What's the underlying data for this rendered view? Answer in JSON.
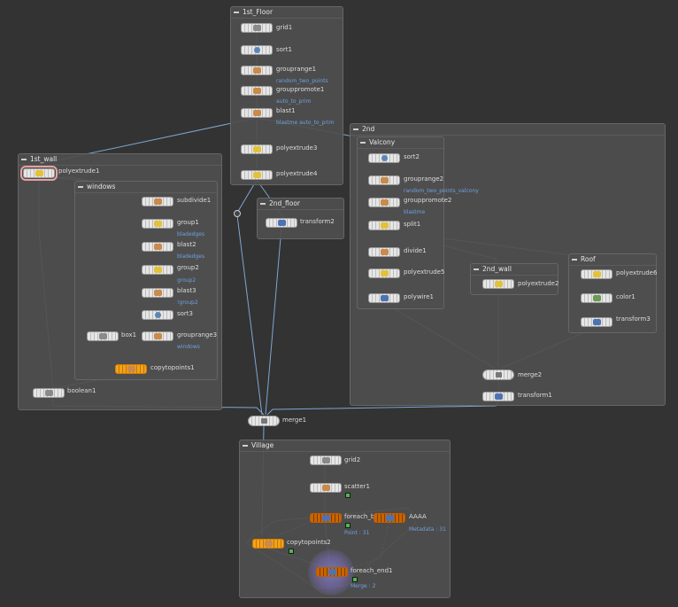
{
  "colors": {
    "wire": "#7fa6d1",
    "wire_orange": "#d9822b",
    "link": "#6fa0e0",
    "green_flag": "#4db84d"
  },
  "boxes": {
    "first_floor": {
      "title": "1st_Floor"
    },
    "first_wall": {
      "title": "1st_wall"
    },
    "windows": {
      "title": "windows"
    },
    "second_floor": {
      "title": "2nd_floor"
    },
    "second": {
      "title": "2nd"
    },
    "valcony": {
      "title": "Valcony"
    },
    "second_wall": {
      "title": "2nd_wall"
    },
    "roof": {
      "title": "Roof"
    },
    "village": {
      "title": "Village"
    }
  },
  "nodes": {
    "grid1": {
      "label": "grid1",
      "icon": "grid-icon"
    },
    "sort1": {
      "label": "sort1",
      "icon": "sort-icon"
    },
    "grouprange1": {
      "label": "grouprange1",
      "sub": "random_two_points",
      "icon": "grouprange-icon"
    },
    "grouppromote1": {
      "label": "grouppromote1",
      "sub": "auto_to_prim",
      "icon": "grouppromote-icon"
    },
    "blast1": {
      "label": "blast1",
      "sub": "blastme auto_to_prim",
      "icon": "blast-icon"
    },
    "polyextrude3": {
      "label": "polyextrude3",
      "icon": "polyextrude-icon"
    },
    "polyextrude4": {
      "label": "polyextrude4",
      "icon": "polyextrude-icon"
    },
    "polyextrude1": {
      "label": "polyextrude1",
      "icon": "polyextrude-icon"
    },
    "subdivide1": {
      "label": "subdivide1",
      "icon": "subdivide-icon"
    },
    "group1": {
      "label": "group1",
      "sub": "bladedges",
      "icon": "group-icon"
    },
    "blast2": {
      "label": "blast2",
      "sub": "bladedges",
      "icon": "blast-icon"
    },
    "group2": {
      "label": "group2",
      "sub": "group2",
      "icon": "group-icon"
    },
    "blast3": {
      "label": "blast3",
      "sub": "!group2",
      "icon": "blast-icon"
    },
    "sort3": {
      "label": "sort3",
      "icon": "sort-icon"
    },
    "box1": {
      "label": "box1",
      "icon": "box-icon"
    },
    "grouprange3": {
      "label": "grouprange3",
      "sub": "windows",
      "icon": "grouprange-icon"
    },
    "copytopoints1": {
      "label": "copytopoints1",
      "icon": "copytopoints-icon"
    },
    "boolean1": {
      "label": "boolean1",
      "icon": "boolean-icon"
    },
    "transform2": {
      "label": "transform2",
      "icon": "transform-icon"
    },
    "sort2": {
      "label": "sort2",
      "icon": "sort-icon"
    },
    "grouprange2": {
      "label": "grouprange2",
      "sub": "random_two_points_valcony",
      "icon": "grouprange-icon"
    },
    "grouppromote2": {
      "label": "grouppromote2",
      "sub": "blastme",
      "icon": "grouppromote-icon"
    },
    "split1": {
      "label": "split1",
      "icon": "split-icon"
    },
    "divide1": {
      "label": "divide1",
      "icon": "divide-icon"
    },
    "polyextrude5": {
      "label": "polyextrude5",
      "icon": "polyextrude-icon"
    },
    "polywire1": {
      "label": "polywire1",
      "icon": "polywire-icon"
    },
    "polyextrude2": {
      "label": "polyextrude2",
      "icon": "polyextrude-icon"
    },
    "polyextrude6": {
      "label": "polyextrude6",
      "icon": "polyextrude-icon"
    },
    "color1": {
      "label": "color1",
      "icon": "color-icon"
    },
    "transform3": {
      "label": "transform3",
      "icon": "transform-icon"
    },
    "merge2": {
      "label": "merge2",
      "icon": "merge-icon"
    },
    "transform1": {
      "label": "transform1",
      "icon": "transform-icon"
    },
    "merge1": {
      "label": "merge1",
      "icon": "merge-icon"
    },
    "grid2": {
      "label": "grid2",
      "icon": "grid-icon"
    },
    "scatter1": {
      "label": "scatter1",
      "icon": "scatter-icon"
    },
    "foreach_begin": {
      "label": "foreach_begin",
      "sub": "Point : 31",
      "icon": "foreach-begin-icon"
    },
    "aaaa": {
      "label": "AAAA",
      "sub": "Metadata : 31",
      "icon": "foreach-begin-icon"
    },
    "copytopoints2": {
      "label": "copytopoints2",
      "icon": "copytopoints-icon"
    },
    "foreach_end1": {
      "label": "foreach_end1",
      "sub": "Merge : 2",
      "icon": "foreach-end-icon"
    }
  }
}
